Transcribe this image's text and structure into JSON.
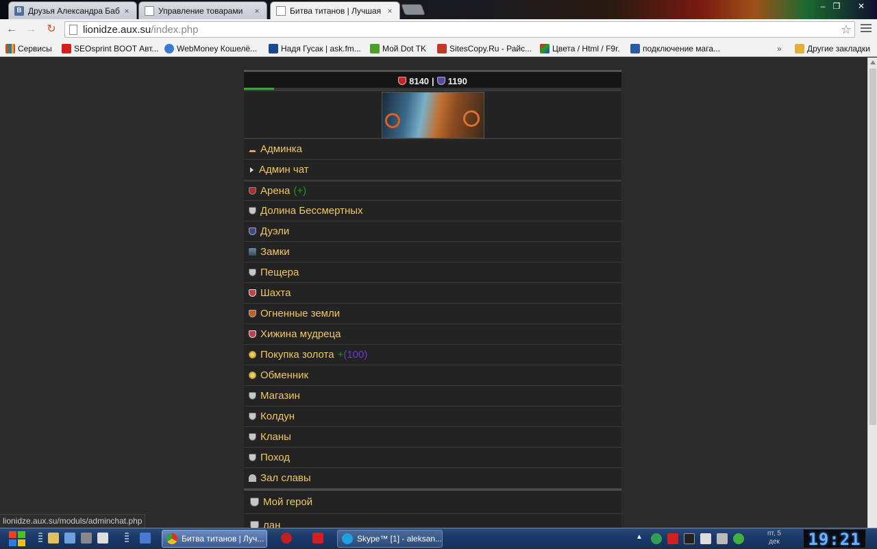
{
  "browser": {
    "tabs": [
      {
        "title": "Друзья Александра Баби",
        "favicon": "vk-icon",
        "fav_text": "В",
        "active": false
      },
      {
        "title": "Управление товарами",
        "favicon": "document-icon",
        "active": false
      },
      {
        "title": "Битва титанов | Лучшая с",
        "favicon": "document-icon",
        "active": true
      }
    ],
    "close_glyph": "×",
    "url_host": "lionidze.aux.su",
    "url_path": "/index.php",
    "star_glyph": "☆",
    "nav": {
      "back": "←",
      "forward": "→",
      "reload": "↻"
    },
    "window_controls": {
      "minimize": "‒",
      "maximize": "❐",
      "close": "✕"
    }
  },
  "bookmarks": [
    {
      "label": "Сервисы",
      "icon": "apps-grid-icon",
      "color": "#e04030"
    },
    {
      "label": "SEOsprint BOOT Авт...",
      "icon": "youtube-icon",
      "color": "#d02020"
    },
    {
      "label": "WebMoney Кошелё...",
      "icon": "webmoney-icon",
      "color": "#3a7ad0"
    },
    {
      "label": "Надя Гусак | ask.fm...",
      "icon": "askfm-icon",
      "color": "#1a4a8a"
    },
    {
      "label": "Мой Dot TK",
      "icon": "dottk-icon",
      "color": "#4aa02a"
    },
    {
      "label": "SitesCopy.Ru - Райс...",
      "icon": "sitescopy-icon",
      "color": "#c03a2a"
    },
    {
      "label": "Цвета / Html / F9r.",
      "icon": "colors-icon",
      "color": "#8a2ab0"
    },
    {
      "label": "подключение мага...",
      "icon": "b-icon",
      "color": "#2a5aa0"
    }
  ],
  "bookmarks_more": "»",
  "other_bookmarks": "Другие закладки",
  "game": {
    "stat_red": "8140",
    "stat_separator": "|",
    "stat_purple": "1190",
    "progress": 0.08,
    "menu": [
      {
        "label": "Админка",
        "icon": "crown-icon",
        "cls": "crown"
      },
      {
        "label": "Админ чат",
        "icon": "arrow-icon",
        "cls": "arrow"
      },
      {
        "label": "Арена",
        "icon": "arena-shield-icon",
        "cls": "sh-red",
        "extra_plus": "(+)",
        "sep": true
      },
      {
        "label": "Долина Бессмертных",
        "icon": "valley-shield-icon",
        "cls": "sh-white"
      },
      {
        "label": "Дуэли",
        "icon": "duel-shield-icon",
        "cls": "sh-blue"
      },
      {
        "label": "Замки",
        "icon": "castle-icon",
        "cls": "castle"
      },
      {
        "label": "Пещера",
        "icon": "cave-shield-icon",
        "cls": "sh-white"
      },
      {
        "label": "Шахта",
        "icon": "mine-shield-icon",
        "cls": "sh-pink"
      },
      {
        "label": "Огненные земли",
        "icon": "fire-shield-icon",
        "cls": "sh-orange"
      },
      {
        "label": "Хижина мудреца",
        "icon": "hut-shield-icon",
        "cls": "sh-pink"
      },
      {
        "label": "Покупка золота",
        "icon": "gold-coin-icon",
        "cls": "coin",
        "plus": "+",
        "num": "(100)"
      },
      {
        "label": "Обменник",
        "icon": "exchange-coin-icon",
        "cls": "coin"
      },
      {
        "label": "Магазин",
        "icon": "shop-shield-icon",
        "cls": "sh-white"
      },
      {
        "label": "Колдун",
        "icon": "wizard-shield-icon",
        "cls": "sh-white"
      },
      {
        "label": "Кланы",
        "icon": "clans-shield-icon",
        "cls": "sh-white"
      },
      {
        "label": "Поход",
        "icon": "campaign-shield-icon",
        "cls": "sh-white"
      },
      {
        "label": "Зал славы",
        "icon": "hall-of-fame-icon",
        "cls": "dome"
      }
    ],
    "menu_bottom": [
      {
        "label": "Мой герой",
        "icon": "hero-icon",
        "cls": "sh-white"
      },
      {
        "label": "лан",
        "icon": "clan-icon",
        "cls": "sh-white"
      }
    ]
  },
  "status_url": "lionidze.aux.su/moduls/adminchat.php",
  "taskbar": {
    "tasks": [
      {
        "label": "Битва титанов | Луч...",
        "icon": "chrome-icon"
      },
      {
        "label": "Skype™ [1] - aleksan...",
        "icon": "skype-icon"
      }
    ],
    "tray_up": "▲",
    "date_line1": "пт, 5",
    "date_line2": "дек",
    "clock": "19:21"
  }
}
